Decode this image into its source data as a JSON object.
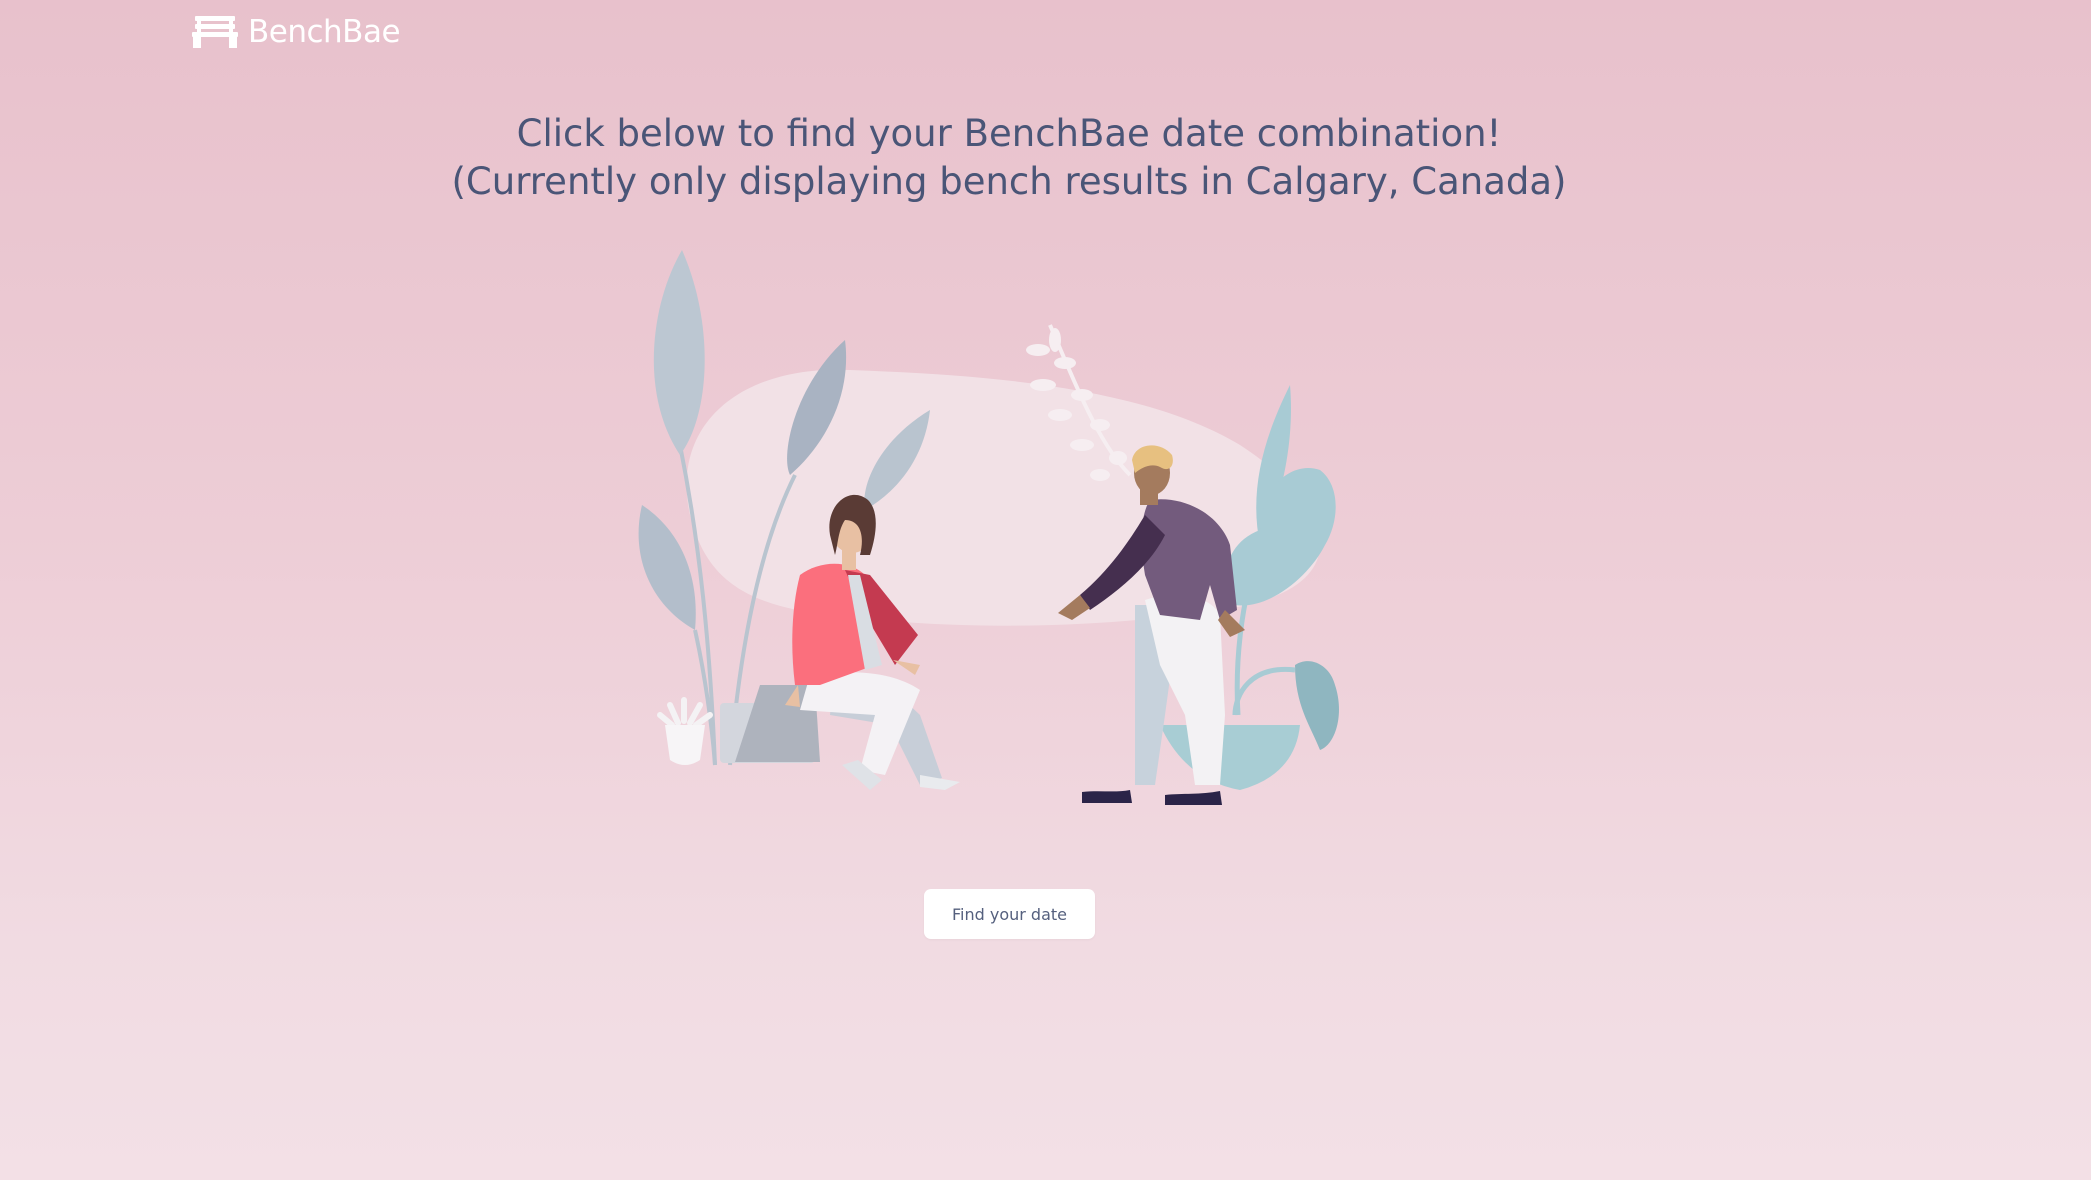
{
  "brand": {
    "name": "BenchBae",
    "logo_icon": "bench-icon"
  },
  "headline": {
    "line1": "Click below to find your BenchBae date combination!",
    "line2": "(Currently only displaying bench results in Calgary, Canada)"
  },
  "hero": {
    "illustration": "couple-meeting-illustration"
  },
  "cta": {
    "label": "Find your date"
  },
  "colors": {
    "background_top": "#e8c1cc",
    "background_bottom": "#f3e0e6",
    "text": "#4a5577",
    "button_bg": "#ffffff"
  }
}
